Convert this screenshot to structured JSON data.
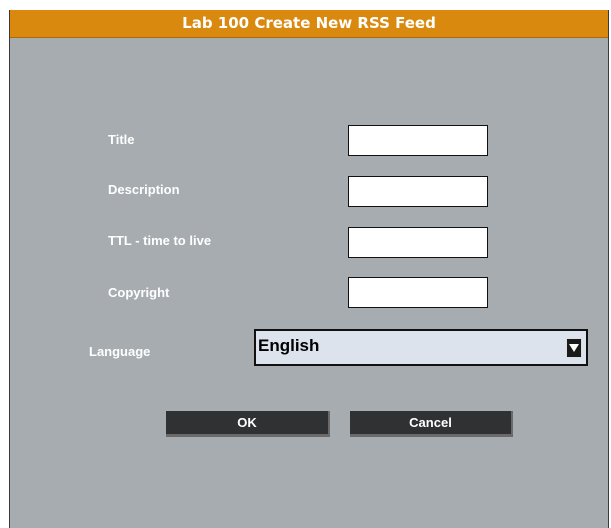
{
  "dialog": {
    "title": "Lab 100 Create New RSS Feed"
  },
  "form": {
    "title_label": "Title",
    "title_value": "",
    "description_label": "Description",
    "description_value": "",
    "ttl_label": "TTL - time to live",
    "ttl_value": "",
    "copyright_label": "Copyright",
    "copyright_value": "",
    "language_label": "Language",
    "language_value": "English"
  },
  "buttons": {
    "ok_label": "OK",
    "cancel_label": "Cancel"
  },
  "colors": {
    "title_bar": "#d9890e",
    "dialog_background": "#a7acb1",
    "button_background": "#2f3133",
    "select_background": "#dce3ec"
  },
  "icons": {
    "dropdown": "triangle-down-icon"
  }
}
